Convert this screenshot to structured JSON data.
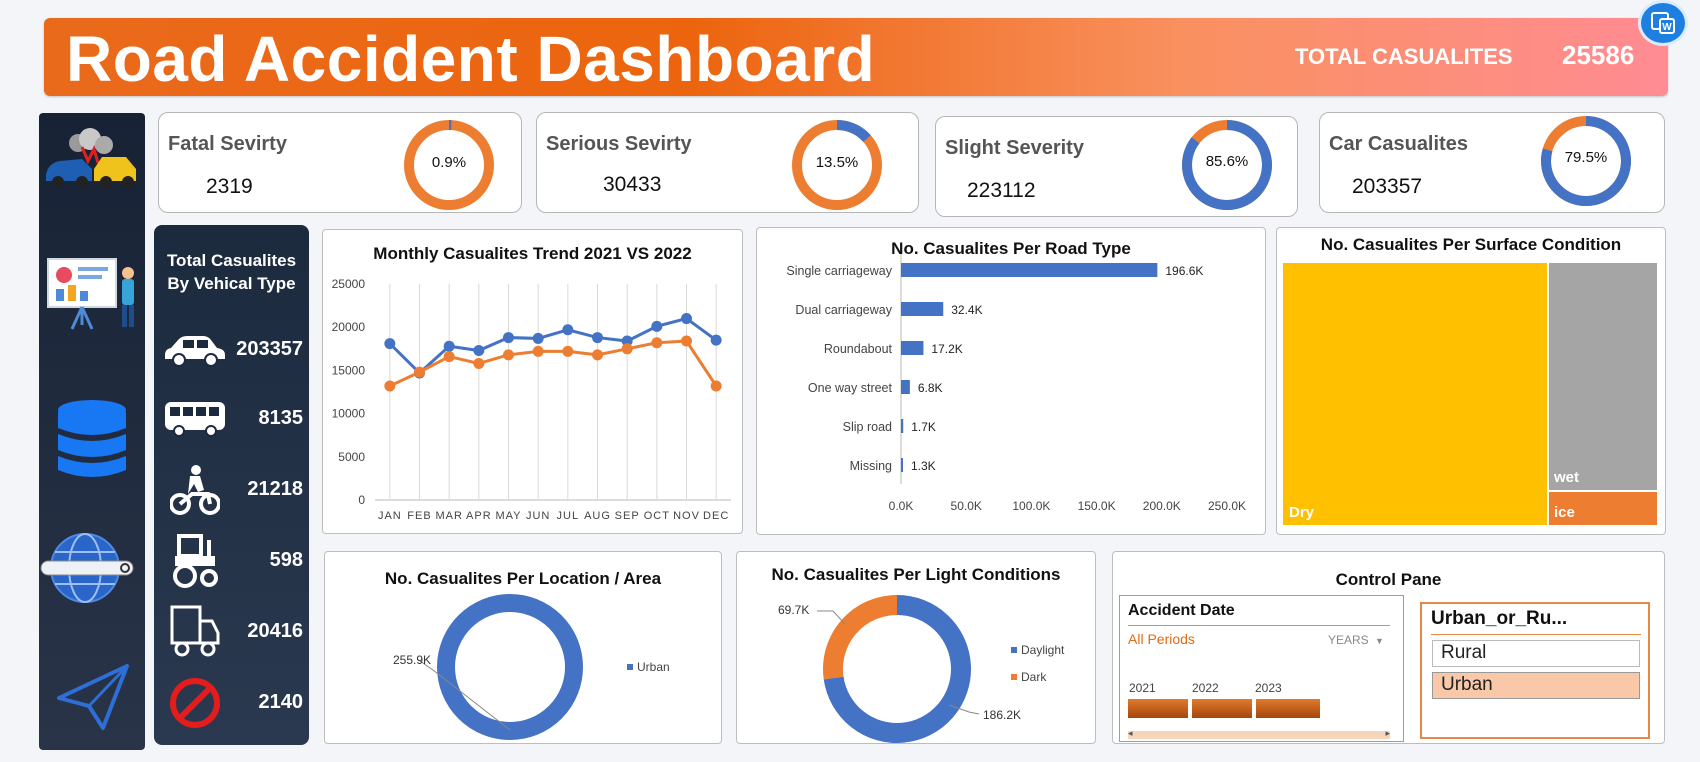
{
  "header": {
    "title": "Road Accident Dashboard",
    "total_label": "TOTAL CASUALITES",
    "total_value": "25586"
  },
  "kpis": [
    {
      "label": "Fatal Sevirty",
      "value": "2319",
      "percent_label": "0.9%",
      "percent": 0.9
    },
    {
      "label": "Serious Sevirty",
      "value": "30433",
      "percent_label": "13.5%",
      "percent": 13.5
    },
    {
      "label": "Slight Severity",
      "value": "223112",
      "percent_label": "85.6%",
      "percent": 85.6
    },
    {
      "label": "Car Casualites",
      "value": "203357",
      "percent_label": "79.5%",
      "percent": 79.5
    }
  ],
  "vehicles": {
    "title_line1": "Total  Casualites",
    "title_line2": "By Vehical Type",
    "items": [
      {
        "icon": "car-icon",
        "value": "203357"
      },
      {
        "icon": "bus-icon",
        "value": "8135"
      },
      {
        "icon": "motorcycle-icon",
        "value": "21218"
      },
      {
        "icon": "tractor-icon",
        "value": "598"
      },
      {
        "icon": "truck-icon",
        "value": "20416"
      },
      {
        "icon": "no-entry-icon",
        "value": "2140"
      }
    ]
  },
  "sidebar_icons": [
    "car-crash-icon",
    "presentation-icon",
    "database-icon",
    "globe-search-icon",
    "paper-plane-icon"
  ],
  "charts": {
    "monthly": {
      "title": "Monthly Casualites Trend 2021 VS 2022",
      "type": "line",
      "categories": [
        "JAN",
        "FEB",
        "MAR",
        "APR",
        "MAY",
        "JUN",
        "JUL",
        "AUG",
        "SEP",
        "OCT",
        "NOV",
        "DEC"
      ],
      "y_ticks": [
        "0",
        "5000",
        "10000",
        "15000",
        "20000",
        "25000"
      ],
      "ylim": [
        0,
        25000
      ],
      "series": [
        {
          "color": "#4472c4",
          "values": [
            18100,
            14700,
            17800,
            17300,
            18800,
            18700,
            19700,
            18800,
            18400,
            20100,
            21000,
            18500
          ]
        },
        {
          "color": "#ed7d31",
          "values": [
            13200,
            14800,
            16600,
            15800,
            16800,
            17200,
            17200,
            16800,
            17500,
            18200,
            18400,
            13200
          ]
        }
      ]
    },
    "road_type": {
      "title": "No. Casualites Per Road Type",
      "type": "bar",
      "categories": [
        "Single carriageway",
        "Dual carriageway",
        "Roundabout",
        "One way street",
        "Slip road",
        "Missing"
      ],
      "values": [
        196600,
        32400,
        17200,
        6800,
        1700,
        1300
      ],
      "value_labels": [
        "196.6K",
        "32.4K",
        "17.2K",
        "6.8K",
        "1.7K",
        "1.3K"
      ],
      "x_ticks": [
        "0.0K",
        "50.0K",
        "100.0K",
        "150.0K",
        "200.0K",
        "250.0K"
      ],
      "xlim": [
        0,
        250000
      ],
      "color": "#4472c4"
    },
    "surface": {
      "title": "No. Casualites Per Surface Condition",
      "type": "treemap",
      "items": [
        {
          "label": "Dry",
          "color": "#ffc000"
        },
        {
          "label": "wet",
          "color": "#a5a5a5"
        },
        {
          "label": "ice",
          "color": "#ed7d31"
        }
      ]
    },
    "location": {
      "title": "No. Casualites Per Location / Area",
      "type": "pie",
      "slices": [
        {
          "name": "Urban",
          "value": 255900,
          "label": "255.9K",
          "color": "#4472c4"
        }
      ],
      "legend": [
        "Urban"
      ]
    },
    "light": {
      "title": "No. Casualites Per Light Conditions",
      "type": "pie",
      "slices": [
        {
          "name": "Daylight",
          "value": 186200,
          "label": "186.2K",
          "color": "#4472c4"
        },
        {
          "name": "Dark",
          "value": 69700,
          "label": "69.7K",
          "color": "#ed7d31"
        }
      ],
      "legend": [
        "Daylight",
        "Dark"
      ]
    }
  },
  "chart_data": [
    {
      "type": "line",
      "title": "Monthly Casualites Trend 2021 VS 2022",
      "categories": [
        "JAN",
        "FEB",
        "MAR",
        "APR",
        "MAY",
        "JUN",
        "JUL",
        "AUG",
        "SEP",
        "OCT",
        "NOV",
        "DEC"
      ],
      "series": [
        {
          "values": [
            18100,
            14700,
            17800,
            17300,
            18800,
            18700,
            19700,
            18800,
            18400,
            20100,
            21000,
            18500
          ]
        },
        {
          "values": [
            13200,
            14800,
            16600,
            15800,
            16800,
            17200,
            17200,
            16800,
            17500,
            18200,
            18400,
            13200
          ]
        }
      ],
      "ylim": [
        0,
        25000
      ],
      "grid": true
    },
    {
      "type": "bar",
      "title": "No. Casualites Per Road Type",
      "categories": [
        "Single carriageway",
        "Dual carriageway",
        "Roundabout",
        "One way street",
        "Slip road",
        "Missing"
      ],
      "values": [
        196600,
        32400,
        17200,
        6800,
        1700,
        1300
      ],
      "xlim": [
        0,
        250000
      ]
    },
    {
      "type": "heatmap",
      "title": "No. Casualites Per Surface Condition",
      "categories": [
        "Dry",
        "wet",
        "ice"
      ]
    },
    {
      "type": "pie",
      "title": "No. Casualites Per Location / Area",
      "categories": [
        "Urban"
      ],
      "values": [
        255900
      ]
    },
    {
      "type": "pie",
      "title": "No. Casualites Per Light Conditions",
      "categories": [
        "Daylight",
        "Dark"
      ],
      "values": [
        186200,
        69700
      ]
    }
  ],
  "control": {
    "title": "Control Pane",
    "date_slicer": {
      "title": "Accident Date",
      "period": "All Periods",
      "unit": "YEARS",
      "years": [
        "2021",
        "2022",
        "2023"
      ]
    },
    "area_slicer": {
      "title": "Urban_or_Ru...",
      "options": [
        "Rural",
        "Urban"
      ],
      "selected": "Urban"
    }
  }
}
